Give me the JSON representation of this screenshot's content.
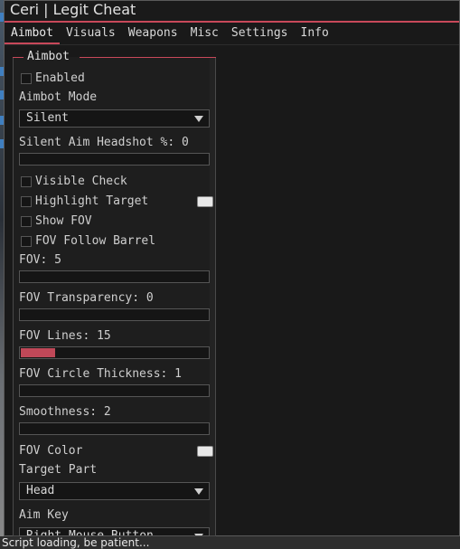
{
  "window": {
    "title": "Ceri | Legit Cheat"
  },
  "tabs": [
    "Aimbot",
    "Visuals",
    "Weapons",
    "Misc",
    "Settings",
    "Info"
  ],
  "active_tab": "Aimbot",
  "group": {
    "title": "Aimbot",
    "enabled_label": "Enabled",
    "mode_label": "Aimbot Mode",
    "mode_value": "Silent",
    "silent_headshot_label": "Silent Aim Headshot %: 0",
    "visible_check_label": "Visible Check",
    "highlight_target_label": "Highlight Target",
    "show_fov_label": "Show FOV",
    "fov_follow_barrel_label": "FOV Follow Barrel",
    "fov_label": "FOV: 5",
    "fov_transparency_label": "FOV Transparency: 0",
    "fov_lines_label": "FOV Lines: 15",
    "fov_lines_fill": 0.18,
    "fov_circle_thickness_label": "FOV Circle Thickness: 1",
    "smoothness_label": "Smoothness: 2",
    "fov_color_label": "FOV Color",
    "target_part_label": "Target Part",
    "target_part_value": "Head",
    "aim_key_label": "Aim Key",
    "aim_key_value": "Right Mouse Button"
  },
  "status_text": "Script loading, be patient...",
  "colors": {
    "accent": "#c8485a",
    "slider_fill": "#c04858",
    "background": "#191919"
  }
}
